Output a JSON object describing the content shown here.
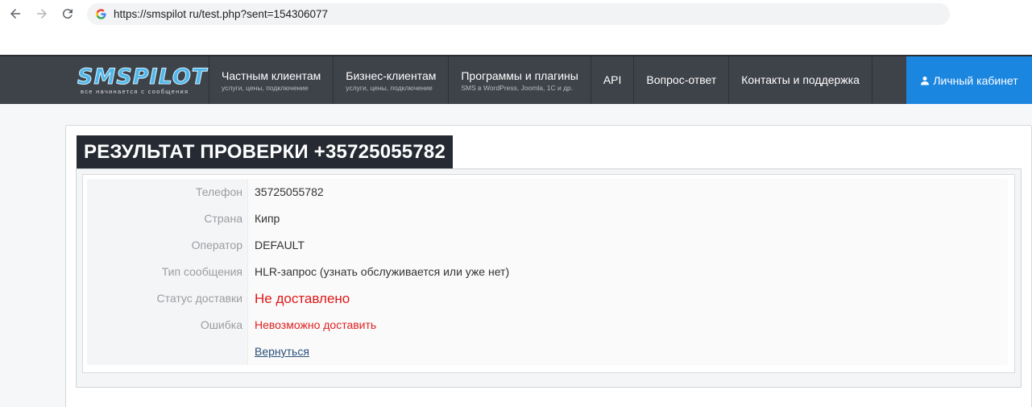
{
  "browser": {
    "url": "https://smspilot ru/test.php?sent=154306077"
  },
  "header": {
    "logo_text": "SMSPILOT",
    "logo_tagline": "все начинается с сообщения",
    "menu": [
      {
        "label": "Частным клиентам",
        "sub": "услуги, цены, подключение"
      },
      {
        "label": "Бизнес-клиентам",
        "sub": "услуги, цены, подключение"
      },
      {
        "label": "Программы и плагины",
        "sub": "SMS в WordPress, Joomla, 1С и др."
      },
      {
        "label": "API",
        "sub": ""
      },
      {
        "label": "Вопрос-ответ",
        "sub": ""
      },
      {
        "label": "Контакты и поддержка",
        "sub": ""
      }
    ],
    "cabinet_label": "Личный кабинет"
  },
  "main": {
    "title": "РЕЗУЛЬТАТ ПРОВЕРКИ +35725055782",
    "rows": [
      {
        "key": "Телефон",
        "value": "35725055782"
      },
      {
        "key": "Страна",
        "value": "Кипр"
      },
      {
        "key": "Оператор",
        "value": "DEFAULT"
      },
      {
        "key": "Тип сообщения",
        "value": "HLR-запрос (узнать обслуживается или уже нет)"
      },
      {
        "key": "Статус доставки",
        "value": "Не доставлено"
      },
      {
        "key": "Ошибка",
        "value": "Невозможно доставить"
      },
      {
        "key": "",
        "value": "Вернуться"
      }
    ]
  },
  "colors": {
    "header_bg": "#3e4249",
    "accent_blue": "#1a86e0",
    "error_red": "#e02020",
    "title_bg": "#262b33"
  }
}
